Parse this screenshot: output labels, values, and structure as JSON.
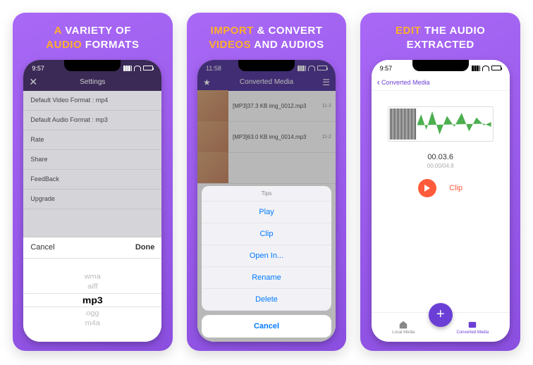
{
  "captions": {
    "a_hl": "A",
    "a_rest": " VARIETY OF",
    "a_hl2": "AUDIO",
    "a_rest2": " FORMATS",
    "b_hl": "IMPORT",
    "b_rest": " & CONVERT",
    "b_hl2": "VIDEOS",
    "b_rest2": " AND AUDIOS",
    "c_hl": "EDIT",
    "c_rest": " THE AUDIO",
    "c_rest2": "EXTRACTED"
  },
  "panelA": {
    "time": "9:57",
    "nav_title": "Settings",
    "rows": [
      "Default Video Format : mp4",
      "Default Audio Format : mp3",
      "Rate",
      "Share",
      "FeedBack",
      "Upgrade"
    ],
    "picker_cancel": "Cancel",
    "picker_done": "Done",
    "wheel": [
      "wma",
      "aiff",
      "mp3",
      "ogg",
      "m4a"
    ]
  },
  "panelB": {
    "time": "11:58",
    "nav_title": "Converted Media",
    "rows": [
      {
        "label": "[MP3]37.3 KB img_0012.mp3",
        "date": "11-2"
      },
      {
        "label": "[MP3]63.0 KB img_0014.mp3",
        "date": "11-2"
      }
    ],
    "sheet_title": "Tips",
    "sheet_opts": [
      "Play",
      "Clip",
      "Open In...",
      "Rename",
      "Delete"
    ],
    "sheet_cancel": "Cancel"
  },
  "panelC": {
    "time": "9:57",
    "back": "Converted Media",
    "cur_time": "00.03.6",
    "total_time": "00:00/04.8",
    "clip": "Clip",
    "tab1": "Local Media",
    "tab2": "Converted Media"
  }
}
